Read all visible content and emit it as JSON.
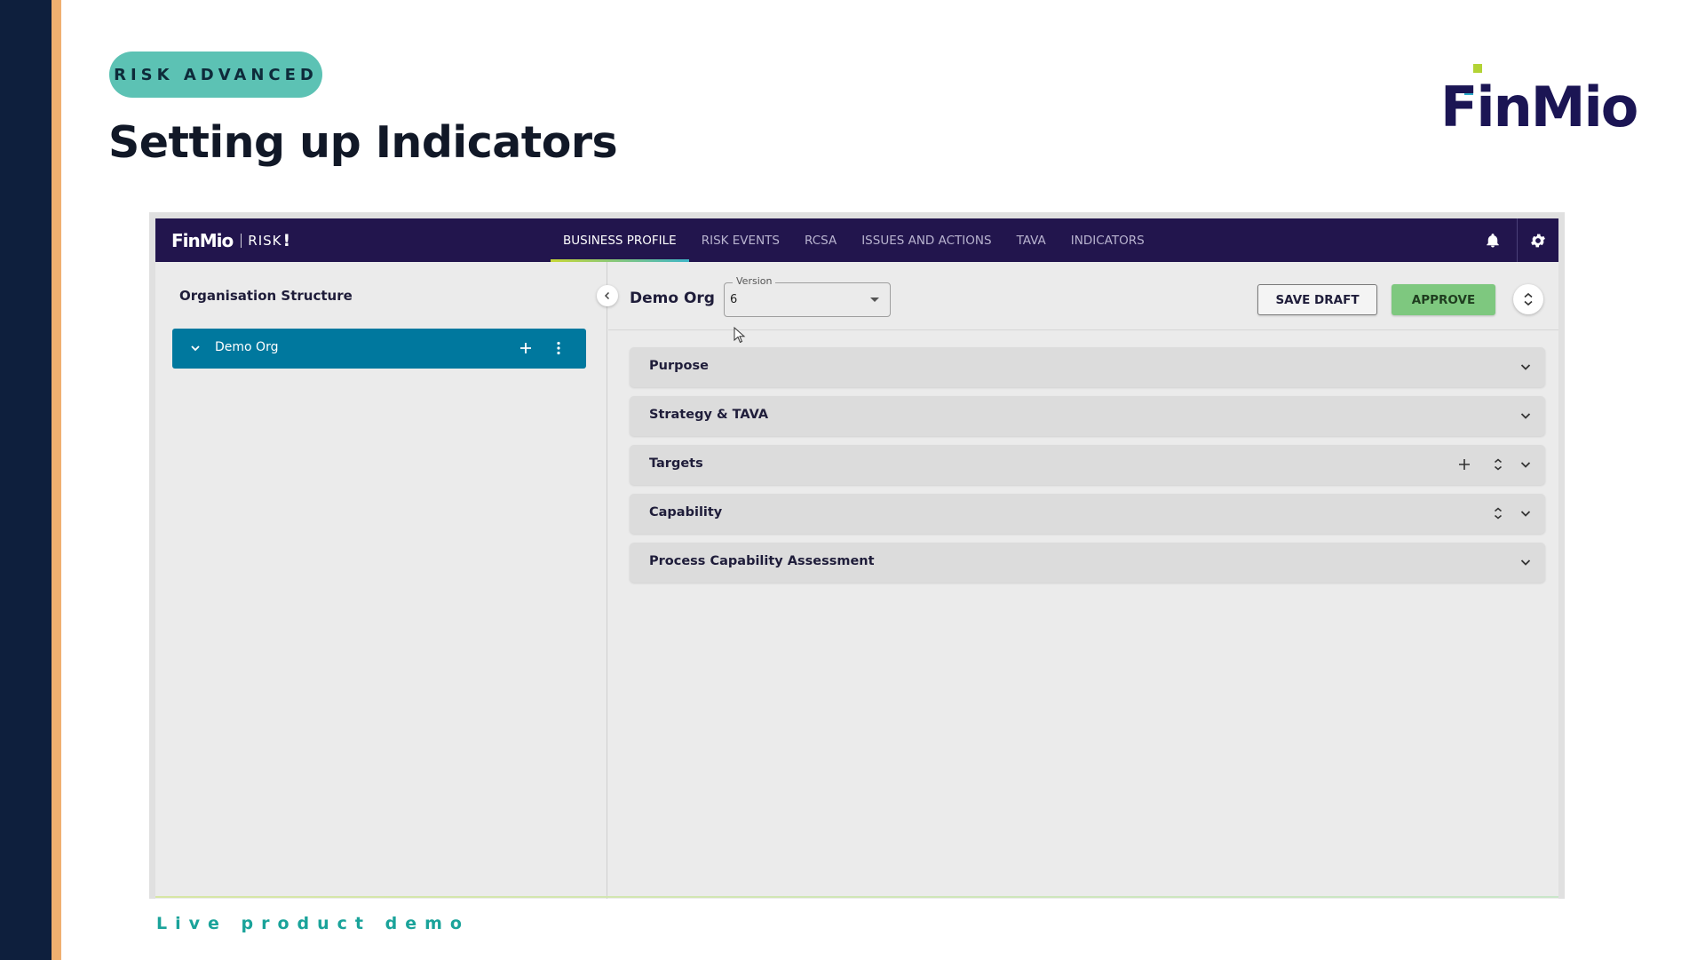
{
  "slide": {
    "tag": "RISK ADVANCED",
    "title": "Setting up Indicators",
    "brand": "FinMio",
    "footer": "Live product demo"
  },
  "app": {
    "nav": {
      "logo_brand": "FinMio",
      "logo_product": "RISK",
      "logo_bang": "!",
      "tabs": [
        {
          "label": "BUSINESS PROFILE",
          "active": true
        },
        {
          "label": "RISK EVENTS",
          "active": false
        },
        {
          "label": "RCSA",
          "active": false
        },
        {
          "label": "ISSUES AND ACTIONS",
          "active": false
        },
        {
          "label": "TAVA",
          "active": false
        },
        {
          "label": "INDICATORS",
          "active": false
        }
      ],
      "icons": [
        "bell-icon",
        "gear-icon"
      ]
    },
    "left_panel": {
      "title": "Organisation Structure",
      "tree": [
        {
          "label": "Demo Org",
          "expanded": true
        }
      ]
    },
    "header": {
      "org_name": "Demo Org",
      "version_label": "Version",
      "version_value": "6",
      "save_draft": "SAVE DRAFT",
      "approve": "APPROVE"
    },
    "sections": [
      {
        "label": "Purpose",
        "icons": [
          "chevron-down-icon"
        ]
      },
      {
        "label": "Strategy & TAVA",
        "icons": [
          "chevron-down-icon"
        ]
      },
      {
        "label": "Targets",
        "icons": [
          "plus-icon",
          "unfold-icon",
          "chevron-down-icon"
        ]
      },
      {
        "label": "Capability",
        "icons": [
          "unfold-icon",
          "chevron-down-icon"
        ]
      },
      {
        "label": "Process Capability Assessment",
        "icons": [
          "chevron-down-icon"
        ]
      }
    ],
    "colors": {
      "nav_bg": "#22154d",
      "tree_selected": "#00789e",
      "approve_bg": "#7ec87f",
      "tag_bg": "#5cc2b4",
      "footer_text": "#1aa39a"
    }
  }
}
